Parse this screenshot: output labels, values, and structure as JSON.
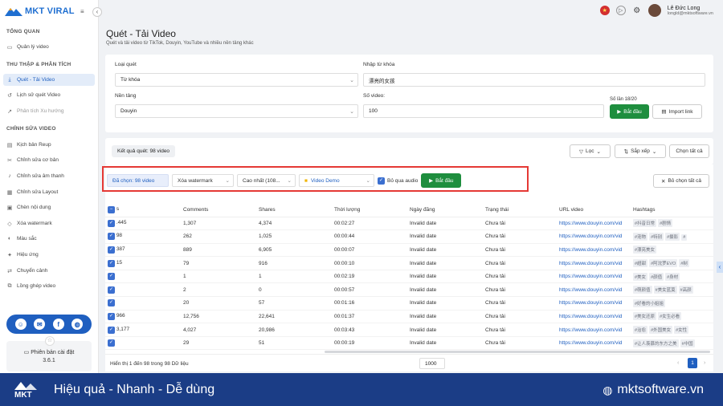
{
  "app": {
    "brand": "MKT VIRAL"
  },
  "user": {
    "name": "Lê Đức Long",
    "email": "longld@mktsoftware.vn"
  },
  "sidebar": {
    "sections": [
      {
        "title": "TỔNG QUAN"
      },
      {
        "title": "THU THẬP & PHÂN TÍCH"
      },
      {
        "title": "CHỈNH SỬA VIDEO"
      }
    ],
    "items": [
      {
        "label": "Quản lý video",
        "icon": "folder-icon"
      },
      {
        "label": "Quét - Tải Video",
        "icon": "download-icon"
      },
      {
        "label": "Lịch sử quét Video",
        "icon": "history-icon"
      },
      {
        "label": "Phân tích Xu hướng",
        "icon": "trend-icon"
      },
      {
        "label": "Kịch bản Reup",
        "icon": "script-icon"
      },
      {
        "label": "Chỉnh sửa cơ bản",
        "icon": "tools-icon"
      },
      {
        "label": "Chỉnh sửa âm thanh",
        "icon": "audio-icon"
      },
      {
        "label": "Chỉnh sửa Layout",
        "icon": "layout-icon"
      },
      {
        "label": "Chèn nội dung",
        "icon": "insert-icon"
      },
      {
        "label": "Xóa watermark",
        "icon": "eraser-icon"
      },
      {
        "label": "Màu sắc",
        "icon": "palette-icon"
      },
      {
        "label": "Hiệu ứng",
        "icon": "effect-icon"
      },
      {
        "label": "Chuyển cảnh",
        "icon": "transition-icon"
      },
      {
        "label": "Lồng ghép video",
        "icon": "merge-icon"
      }
    ],
    "version_label": "Phiên bản cài đặt",
    "version": "3.6.1"
  },
  "page": {
    "title": "Quét - Tải Video",
    "subtitle": "Quét và tải video từ TikTok, Douyin, YouTube và nhiều nền tảng khác"
  },
  "form": {
    "scan_type_label": "Loại quét",
    "scan_type_value": "Từ khóa",
    "keyword_label": "Nhập từ khóa",
    "keyword_value": "漂亮的女孩",
    "platform_label": "Nền tảng",
    "platform_value": "Douyin",
    "count_label": "Số video:",
    "count_value": "100",
    "times_left": "Số lần 18/20",
    "start_label": "Bắt đầu",
    "import_label": "Import link"
  },
  "results": {
    "badge": "Kết quả quét: 98 video",
    "filter_label": "Lọc",
    "sort_label": "Sắp xếp",
    "select_all_label": "Chọn tất cả"
  },
  "toolbar": {
    "selected": "Đã chọn: 98 video",
    "watermark": "Xóa watermark",
    "quality": "Cao nhất (108...",
    "folder": "Video Demo",
    "skip_audio": "Bỏ qua audio",
    "start": "Bắt đầu",
    "deselect_all": "Bỏ chọn tất cả"
  },
  "table": {
    "headers": [
      "s",
      "Comments",
      "Shares",
      "Thời lượng",
      "Ngày đăng",
      "Trạng thái",
      "URL video",
      "Hashtags"
    ],
    "rows": [
      {
        "a": ".445",
        "comments": "1,307",
        "shares": "4,374",
        "duration": "00:02:27",
        "date": "Invalid date",
        "status": "Chưa tải",
        "url": "https://www.douyin.com/vid",
        "tags": [
          "#抖音日常",
          "#剧情"
        ]
      },
      {
        "a": "98",
        "comments": "262",
        "shares": "1,025",
        "duration": "00:00:44",
        "date": "Invalid date",
        "status": "Chưa tải",
        "url": "https://www.douyin.com/vid",
        "tags": [
          "#宠物",
          "#特别",
          "#摄影",
          "#"
        ]
      },
      {
        "a": "387",
        "comments": "889",
        "shares": "6,905",
        "duration": "00:00:07",
        "date": "Invalid date",
        "status": "Chưa tải",
        "url": "https://www.douyin.com/vid",
        "tags": [
          "#漂亮美女"
        ]
      },
      {
        "a": "15",
        "comments": "79",
        "shares": "916",
        "duration": "00:00:10",
        "date": "Invalid date",
        "status": "Chưa tải",
        "url": "https://www.douyin.com/vid",
        "tags": [
          "#超甜",
          "#阿沈罗EVO",
          "#制"
        ]
      },
      {
        "a": "",
        "comments": "1",
        "shares": "1",
        "duration": "00:02:19",
        "date": "Invalid date",
        "status": "Chưa tải",
        "url": "https://www.douyin.com/vid",
        "tags": [
          "#美女",
          "#颜值",
          "#身材"
        ]
      },
      {
        "a": "",
        "comments": "2",
        "shares": "0",
        "duration": "00:00:57",
        "date": "Invalid date",
        "status": "Chưa tải",
        "url": "https://www.douyin.com/vid",
        "tags": [
          "#萌颜值",
          "#美女蓝莫",
          "#高颜"
        ]
      },
      {
        "a": "",
        "comments": "20",
        "shares": "57",
        "duration": "00:01:16",
        "date": "Invalid date",
        "status": "Chưa tải",
        "url": "https://www.douyin.com/vid",
        "tags": [
          "#好看的小姐姐"
        ]
      },
      {
        "a": "966",
        "comments": "12,756",
        "shares": "22,641",
        "duration": "00:01:37",
        "date": "Invalid date",
        "status": "Chưa tải",
        "url": "https://www.douyin.com/vid",
        "tags": [
          "#美女还原",
          "#女生必看"
        ]
      },
      {
        "a": "3,177",
        "comments": "4,027",
        "shares": "20,986",
        "duration": "00:03:43",
        "date": "Invalid date",
        "status": "Chưa tải",
        "url": "https://www.douyin.com/vid",
        "tags": [
          "#治愈",
          "#外国美女",
          "#女性"
        ]
      },
      {
        "a": "",
        "comments": "29",
        "shares": "51",
        "duration": "00:00:19",
        "date": "Invalid date",
        "status": "Chưa tải",
        "url": "https://www.douyin.com/vid",
        "tags": [
          "#让人羡慕的东方之美",
          "#中国"
        ]
      }
    ]
  },
  "pagination": {
    "info": "Hiển thị 1 đến 98 trong 98 Dữ liệu",
    "page_size": "1000",
    "current": "1"
  },
  "banner": {
    "slogan": "Hiệu quả - Nhanh - Dễ dùng",
    "website": "mktsoftware.vn",
    "logo_text": "MKT"
  },
  "colors": {
    "brand_blue": "#1b3d86",
    "accent_green": "#1e8e3e",
    "highlight_red": "#e53935"
  }
}
